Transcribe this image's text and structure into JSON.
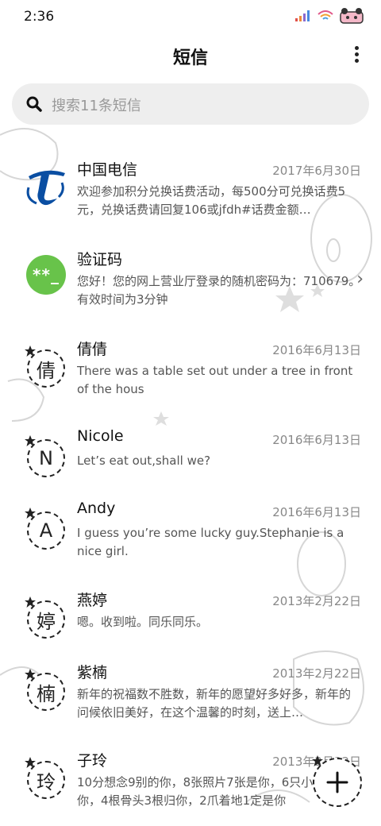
{
  "status_bar": {
    "time": "2:36"
  },
  "header": {
    "title": "短信"
  },
  "search": {
    "placeholder": "搜索11条短信"
  },
  "messages": [
    {
      "name": "中国电信",
      "date": "2017年6月30日",
      "preview": "欢迎参加积分兑换话费活动，每500分可兑换话费5元，兑换话费请回复106或jfdh#话费金额…",
      "avatar": "china-telecom-logo"
    },
    {
      "name": "验证码",
      "date": "",
      "preview": "您好！您的网上营业厅登录的随机密码为：710679。有效时间为3分钟",
      "avatar_text": "**_"
    },
    {
      "name": "倩倩",
      "date": "2016年6月13日",
      "preview": "There was a table set out under a tree in front of the hous",
      "avatar_text": "倩"
    },
    {
      "name": "Nicole",
      "date": "2016年6月13日",
      "preview": "Let’s eat out,shall we?",
      "avatar_text": "N"
    },
    {
      "name": "Andy",
      "date": "2016年6月13日",
      "preview": "I guess you’re some lucky guy.Stephanie is a nice girl.",
      "avatar_text": "A"
    },
    {
      "name": "燕婷",
      "date": "2013年2月22日",
      "preview": "嗯。收到啦。同乐同乐。",
      "avatar_text": "婷"
    },
    {
      "name": "紫楠",
      "date": "2013年2月22日",
      "preview": "新年的祝福数不胜数，新年的愿望好多好多，新年的问候依旧美好，在这个温馨的时刻，送上…",
      "avatar_text": "楠"
    },
    {
      "name": "子玲",
      "date": "2013年2月22日",
      "preview": "10分想念9别的你，8张照片7张是你，6只小狗只像你，4根骨头3根归你，2爪着地1定是你",
      "avatar_text": "玲"
    }
  ],
  "colors": {
    "accent_green": "#68c34a",
    "telecom_blue": "#0a4ea2",
    "search_bg": "#eeeeee"
  },
  "icons": [
    "signal-icon",
    "wifi-icon",
    "battery-icon",
    "more-icon",
    "search-icon",
    "chevron-right-icon",
    "compose-icon"
  ]
}
